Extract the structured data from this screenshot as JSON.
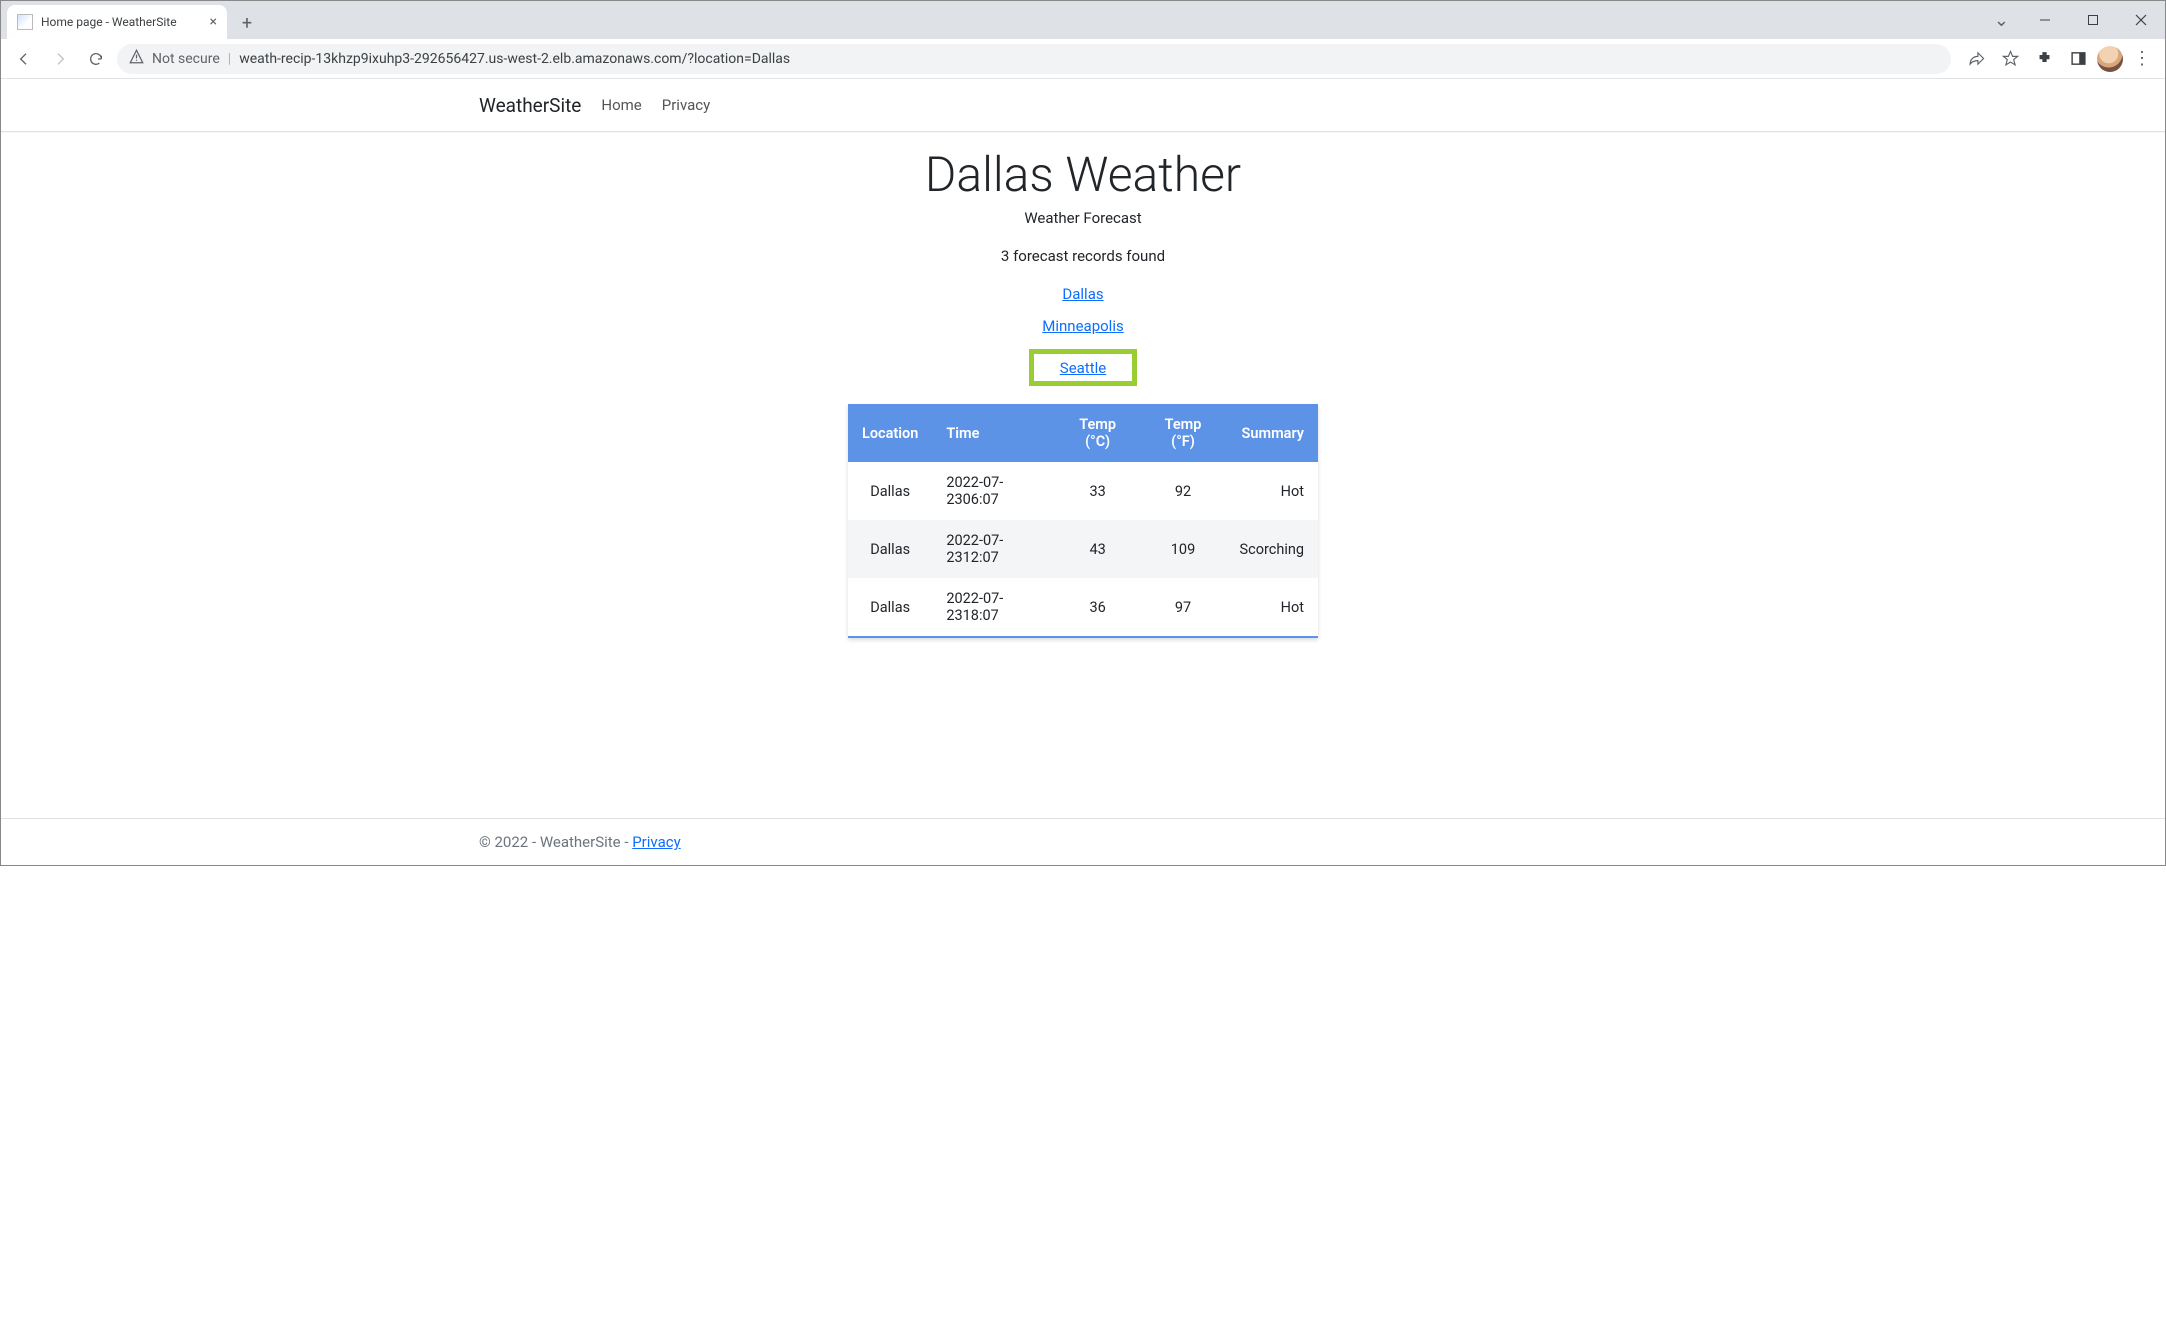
{
  "browser": {
    "tab_title": "Home page - WeatherSite",
    "not_secure_label": "Not secure",
    "url": "weath-recip-13khzp9ixuhp3-292656427.us-west-2.elb.amazonaws.com/?location=Dallas"
  },
  "header": {
    "brand": "WeatherSite",
    "nav": {
      "home": "Home",
      "privacy": "Privacy"
    }
  },
  "main": {
    "title": "Dallas Weather",
    "subtitle": "Weather Forecast",
    "records_found": "3 forecast records found",
    "location_links": {
      "dallas": "Dallas",
      "minneapolis": "Minneapolis",
      "seattle": "Seattle"
    },
    "table": {
      "headers": {
        "location": "Location",
        "time": "Time",
        "temp_c": "Temp (°C)",
        "temp_f": "Temp (°F)",
        "summary": "Summary"
      },
      "rows": [
        {
          "location": "Dallas",
          "time": "2022-07-2306:07",
          "temp_c": "33",
          "temp_f": "92",
          "summary": "Hot"
        },
        {
          "location": "Dallas",
          "time": "2022-07-2312:07",
          "temp_c": "43",
          "temp_f": "109",
          "summary": "Scorching"
        },
        {
          "location": "Dallas",
          "time": "2022-07-2318:07",
          "temp_c": "36",
          "temp_f": "97",
          "summary": "Hot"
        }
      ]
    }
  },
  "footer": {
    "copyright": "© 2022 - WeatherSite - ",
    "privacy_link": "Privacy"
  }
}
